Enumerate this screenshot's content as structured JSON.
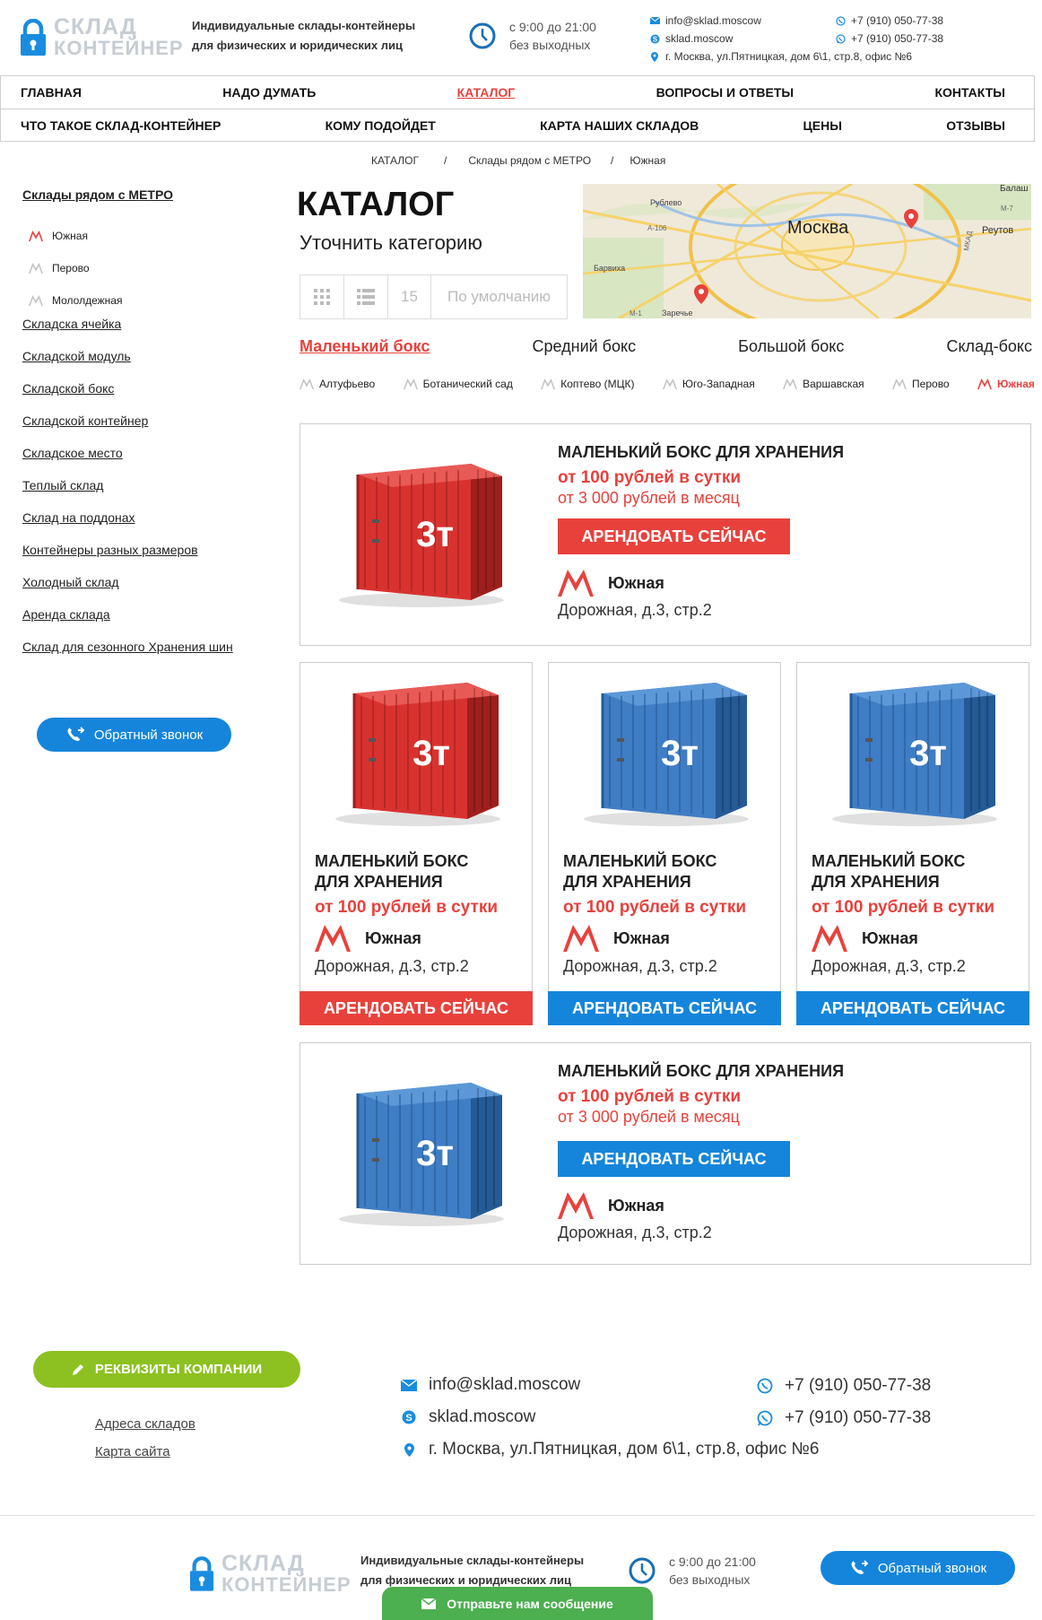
{
  "colors": {
    "accent_red": "#e8413c",
    "accent_blue": "#1585db",
    "accent_green": "#8dc121",
    "chat_green": "#4caf50",
    "logo_blue": "#1a8ce0",
    "logo_gray": "#c7cdd4"
  },
  "header": {
    "logo_line1": "СКЛАД",
    "logo_line2": "КОНТЕЙНЕР",
    "tagline_line1": "Индивидуальные склады-контейнеры",
    "tagline_line2": "для физических и юридических лиц",
    "hours_line1": "с 9:00 до 21:00",
    "hours_line2": "без выходных",
    "email": "info@sklad.moscow",
    "skype": "sklad.moscow",
    "address": "г. Москва, ул.Пятницкая, дом 6\\1, стр.8, офис №6",
    "phone_viber": "+7 (910) 050-77-38",
    "phone_whatsapp": "+7 (910) 050-77-38",
    "icons": [
      "lock-icon",
      "clock-icon",
      "mail-icon",
      "skype-icon",
      "pin-icon",
      "viber-icon",
      "whatsapp-icon"
    ]
  },
  "nav": {
    "row1": [
      {
        "label": "ГЛАВНАЯ"
      },
      {
        "label": "НАДО ДУМАТЬ"
      },
      {
        "label": "КАТАЛОГ",
        "active": true
      },
      {
        "label": "ВОПРОСЫ И ОТВЕТЫ"
      },
      {
        "label": "КОНТАКТЫ"
      }
    ],
    "row2": [
      {
        "label": "ЧТО ТАКОЕ СКЛАД-КОНТЕЙНЕР"
      },
      {
        "label": "КОМУ ПОДОЙДЕТ"
      },
      {
        "label": "КАРТА НАШИХ СКЛАДОВ"
      },
      {
        "label": "ЦЕНЫ"
      },
      {
        "label": "ОТЗЫВЫ"
      }
    ]
  },
  "breadcrumb": [
    "КАТАЛОГ",
    "Склады рядом с МЕТРО",
    "Южная"
  ],
  "sidebar": {
    "metro_heading": "Склады рядом с МЕТРО",
    "metro_items": [
      {
        "label": "Южная",
        "active": true
      },
      {
        "label": "Перово"
      },
      {
        "label": "Мололдежная"
      }
    ],
    "categories": [
      "Складска ячейка",
      "Складской модуль",
      "Складской бокс",
      "Складской контейнер",
      "Складское место",
      "Теплый склад",
      "Склад на поддонах",
      "Контейнеры разных размеров",
      "Холодный склад",
      "Аренда склада",
      "Склад для сезонного Хранения шин"
    ],
    "callback_label": "Обратный звонок"
  },
  "catalog": {
    "title": "КАТАЛОГ",
    "subtitle": "Уточнить категорию",
    "per_page": "15",
    "sort_placeholder": "По умолчанию",
    "size_tabs": [
      {
        "label": "Маленький бокс",
        "active": true
      },
      {
        "label": "Средний бокс"
      },
      {
        "label": "Большой бокс"
      },
      {
        "label": "Склад-бокс"
      }
    ],
    "metro_tabs": [
      {
        "label": "Алтуфьево"
      },
      {
        "label": "Ботанический сад"
      },
      {
        "label": "Коптево (МЦК)"
      },
      {
        "label": "Юго-Западная"
      },
      {
        "label": "Варшавская"
      },
      {
        "label": "Перово"
      },
      {
        "label": "Южная",
        "active": true
      }
    ]
  },
  "map": {
    "city": "Москва",
    "labels": [
      "Балаш",
      "Рублево",
      "Реутов",
      "Барвиха",
      "Заречье",
      "А-106",
      "МКАД",
      "М-7",
      "М-1"
    ]
  },
  "products": [
    {
      "layout": "wide",
      "title": "МАЛЕНЬКИЙ БОКС ДЛЯ ХРАНЕНИЯ",
      "price_day": "от 100 рублей в сутки",
      "price_month": "от 3 000 рублей в месяц",
      "button": "АРЕНДОВАТЬ СЕЙЧАС",
      "metro": "Южная",
      "address": "Дорожная, д.3, стр.2",
      "color": "red",
      "weight": "3т"
    },
    {
      "layout": "small",
      "title_line1": "МАЛЕНЬКИЙ БОКС",
      "title_line2": "ДЛЯ ХРАНЕНИЯ",
      "price_day": "от 100 рублей в сутки",
      "button": "АРЕНДОВАТЬ СЕЙЧАС",
      "metro": "Южная",
      "address": "Дорожная, д.3, стр.2",
      "color": "red",
      "weight": "3т"
    },
    {
      "layout": "small",
      "title_line1": "МАЛЕНЬКИЙ БОКС",
      "title_line2": "ДЛЯ ХРАНЕНИЯ",
      "price_day": "от 100 рублей в сутки",
      "button": "АРЕНДОВАТЬ СЕЙЧАС",
      "metro": "Южная",
      "address": "Дорожная, д.3, стр.2",
      "color": "blue",
      "weight": "3т"
    },
    {
      "layout": "small",
      "title_line1": "МАЛЕНЬКИЙ БОКС",
      "title_line2": "ДЛЯ ХРАНЕНИЯ",
      "price_day": "от 100 рублей в сутки",
      "button": "АРЕНДОВАТЬ СЕЙЧАС",
      "metro": "Южная",
      "address": "Дорожная, д.3, стр.2",
      "color": "blue",
      "weight": "3т"
    },
    {
      "layout": "wide",
      "title": "МАЛЕНЬКИЙ БОКС ДЛЯ ХРАНЕНИЯ",
      "price_day": "от 100 рублей в сутки",
      "price_month": "от 3 000 рублей в месяц",
      "button": "АРЕНДОВАТЬ СЕЙЧАС",
      "metro": "Южная",
      "address": "Дорожная, д.3, стр.2",
      "color": "blue",
      "weight": "3т"
    }
  ],
  "footer": {
    "requisites_button": "РЕКВИЗИТЫ КОМПАНИИ",
    "links": [
      "Адреса складов",
      "Карта сайта"
    ],
    "email": "info@sklad.moscow",
    "skype": "sklad.moscow",
    "address": "г. Москва, ул.Пятницкая, дом 6\\1, стр.8, офис №6",
    "phone_viber": "+7 (910) 050-77-38",
    "phone_whatsapp": "+7 (910) 050-77-38",
    "logo_line1": "СКЛАД",
    "logo_line2": "КОНТЕЙНЕР",
    "tagline_line1": "Индивидуальные склады-контейнеры",
    "tagline_line2": "для физических и юридических лиц",
    "hours_line1": "с 9:00 до 21:00",
    "hours_line2": "без выходных",
    "callback_label": "Обратный звонок",
    "message_widget": "Отправьте нам сообщение"
  }
}
